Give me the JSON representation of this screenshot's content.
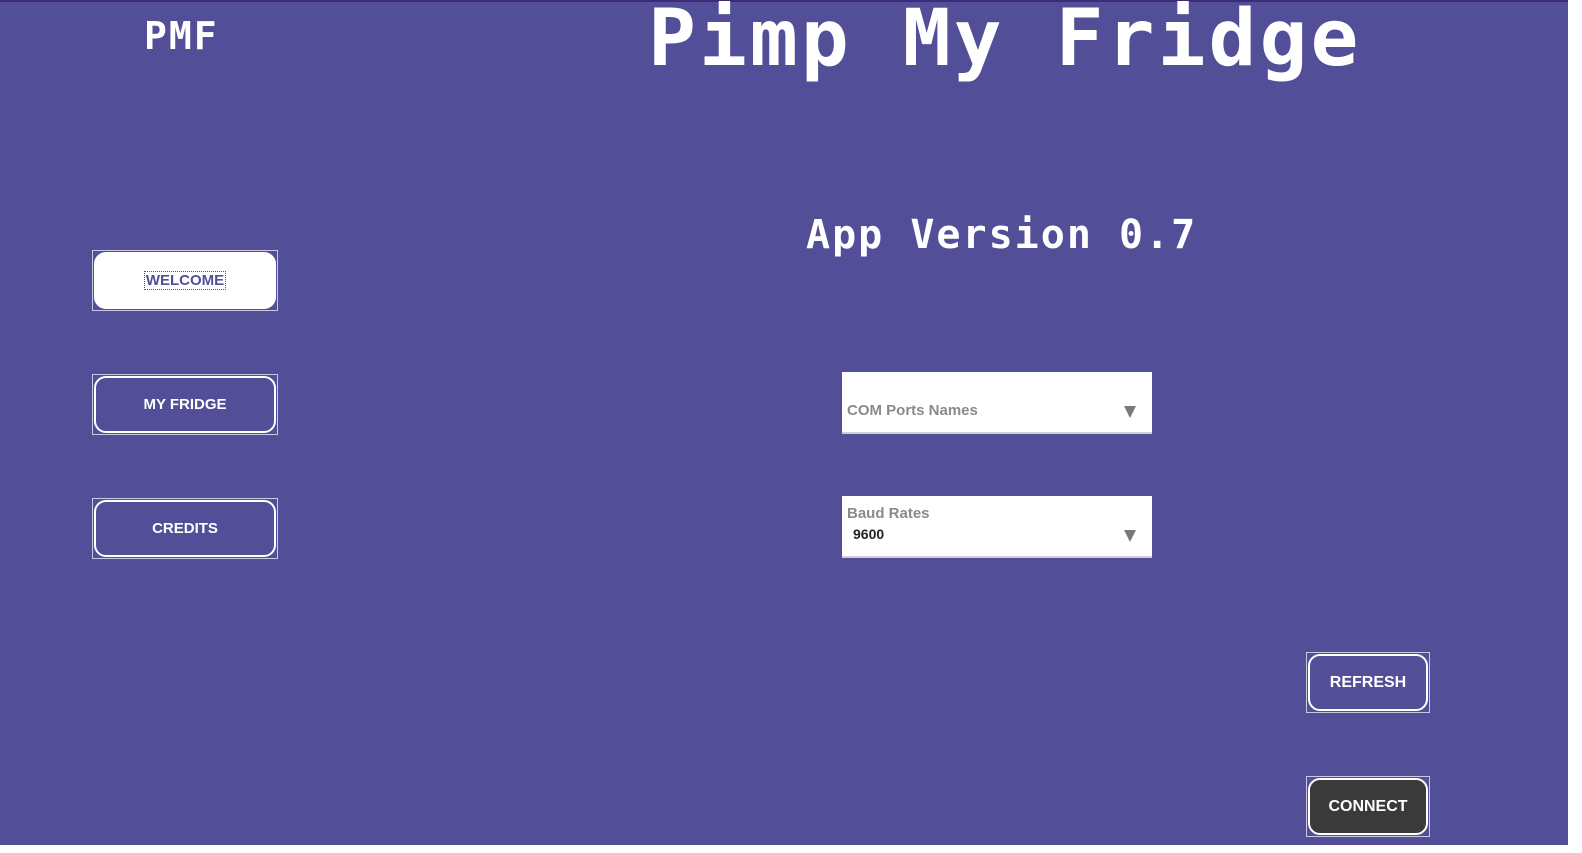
{
  "header": {
    "logo": "PMF",
    "title": "Pimp My Fridge"
  },
  "app_version": "App Version 0.7",
  "sidebar": {
    "items": [
      {
        "label": "WELCOME",
        "active": true
      },
      {
        "label": "MY FRIDGE",
        "active": false
      },
      {
        "label": "CREDITS",
        "active": false
      }
    ]
  },
  "com_ports": {
    "label": "COM Ports Names",
    "value": ""
  },
  "baud_rates": {
    "label": "Baud Rates",
    "value": "9600"
  },
  "actions": {
    "refresh_label": "REFRESH",
    "connect_label": "CONNECT"
  },
  "colors": {
    "background": "#524f98",
    "button_text": "#ffffff",
    "connect_background": "#3a3a3a"
  }
}
